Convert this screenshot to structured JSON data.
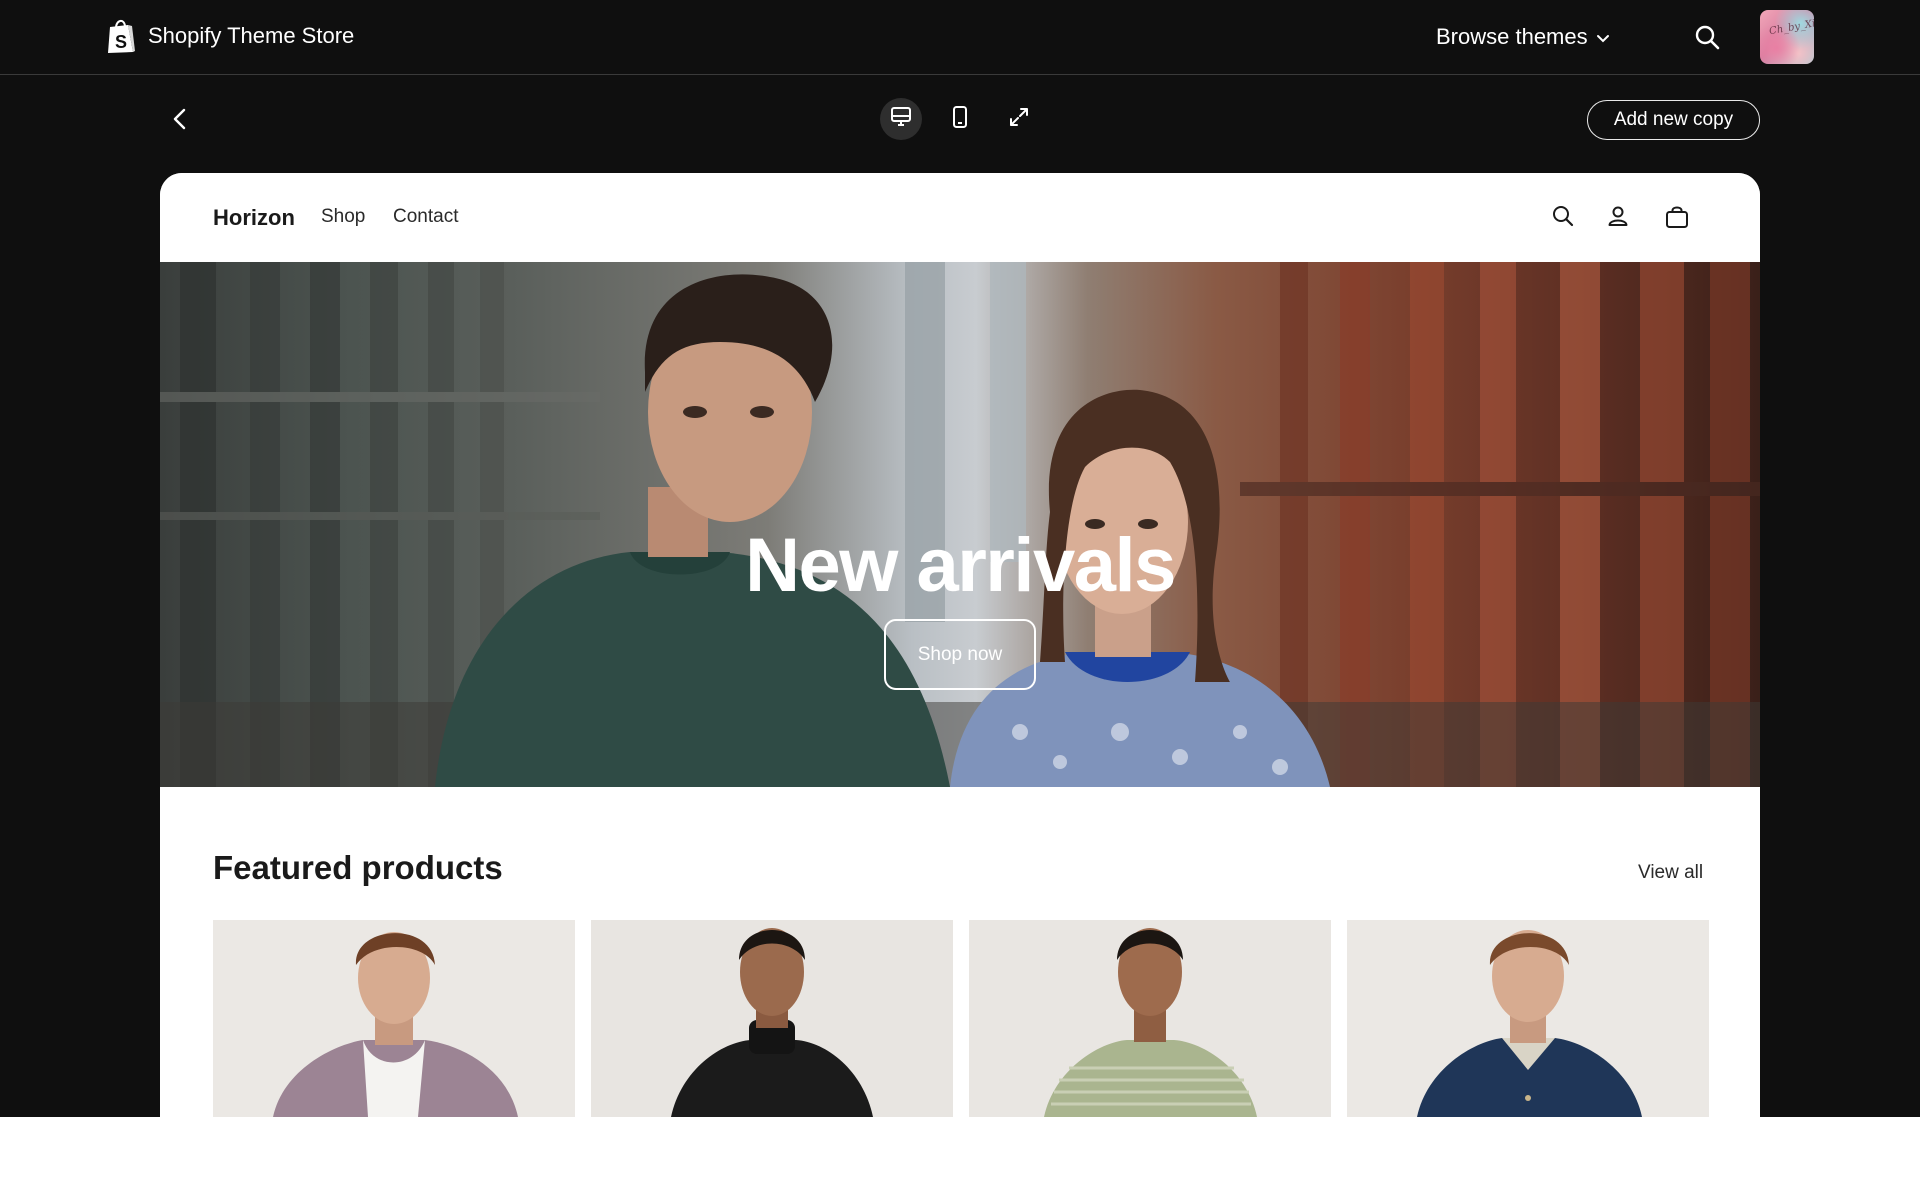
{
  "topnav": {
    "brand_label": "Shopify Theme Store",
    "browse_label": "Browse themes",
    "icons": [
      "shopify-bag-icon",
      "chevron-down-icon",
      "search-icon"
    ],
    "avatar_text": "Ch_by_Xii"
  },
  "toolbar": {
    "back_icon": "chevron-left-icon",
    "views": [
      "desktop-view-icon",
      "mobile-view-icon",
      "fullscreen-icon"
    ],
    "active_view": "desktop",
    "add_copy_label": "Add new copy"
  },
  "store": {
    "logo": "Horizon",
    "nav": [
      "Shop",
      "Contact"
    ],
    "header_icons": [
      "search-icon",
      "account-icon",
      "cart-bag-icon"
    ],
    "hero": {
      "title": "New arrivals",
      "button_label": "Shop now"
    },
    "featured": {
      "title": "Featured products",
      "view_all_label": "View all",
      "products": [
        {
          "image": "man-lilac-cardigan"
        },
        {
          "image": "woman-black-turtleneck"
        },
        {
          "image": "woman-striped-knit"
        },
        {
          "image": "man-denim-jacket"
        }
      ]
    }
  },
  "colors": {
    "app_background": "#0f0f0f",
    "preview_background": "#ffffff",
    "text_light": "#ffffff",
    "text_dark": "#1a1a1a"
  }
}
